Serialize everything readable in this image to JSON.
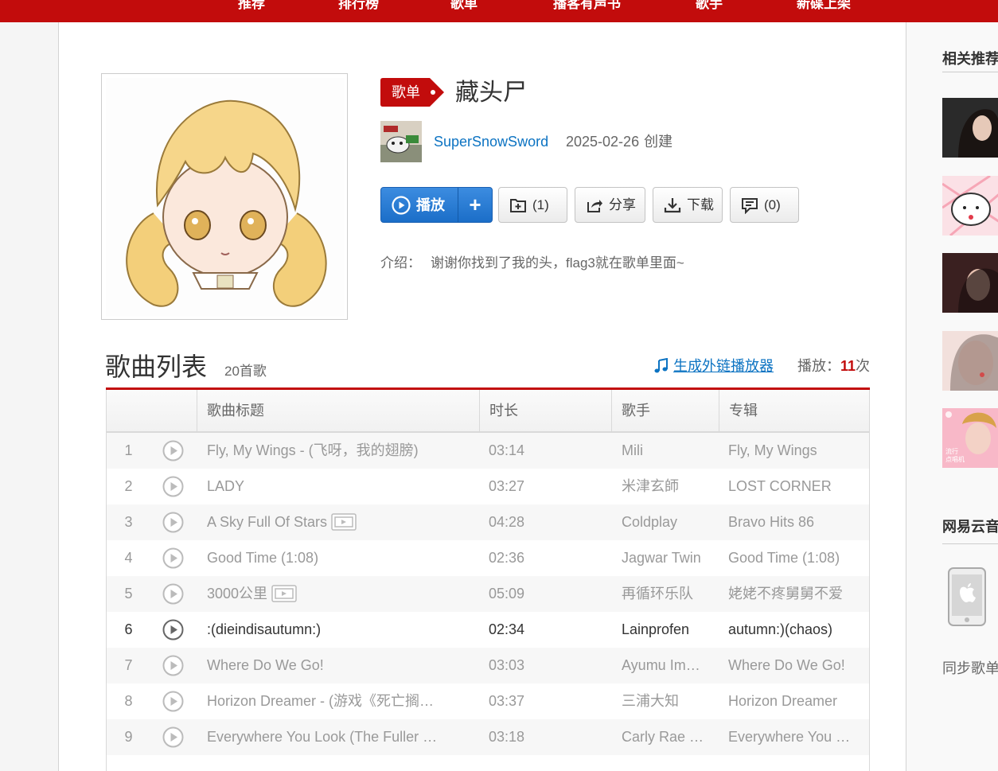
{
  "nav": {
    "items": [
      "推荐",
      "排行榜",
      "歌单",
      "播客有声书",
      "歌手",
      "新碟上架"
    ]
  },
  "playlist": {
    "badge": "歌单",
    "title": "藏头尸",
    "creator": "SuperSnowSword",
    "created_date": "2025-02-26",
    "created_suffix": "创建",
    "intro_label": "介绍：",
    "intro_text": "谢谢你找到了我的头，flag3就在歌单里面~"
  },
  "buttons": {
    "play": "播放",
    "add": "+",
    "collect": "(1)",
    "share": "分享",
    "download": "下载",
    "comment": "(0)"
  },
  "songlist": {
    "title": "歌曲列表",
    "count": "20首歌",
    "ext_player": "生成外链播放器",
    "play_label": "播放：",
    "play_count": "11",
    "play_unit": "次",
    "headers": [
      "",
      "歌曲标题",
      "时长",
      "歌手",
      "专辑"
    ],
    "rows": [
      {
        "idx": "1",
        "title": "Fly, My Wings - (飞呀，我的翅膀)",
        "mv": false,
        "duration": "03:14",
        "artist": "Mili",
        "album": "Fly, My Wings",
        "active": false
      },
      {
        "idx": "2",
        "title": "LADY",
        "mv": false,
        "duration": "03:27",
        "artist": "米津玄師",
        "album": "LOST CORNER",
        "active": false
      },
      {
        "idx": "3",
        "title": "A Sky Full Of Stars",
        "mv": true,
        "duration": "04:28",
        "artist": "Coldplay",
        "album": "Bravo Hits 86",
        "active": false
      },
      {
        "idx": "4",
        "title": "Good Time (1:08)",
        "mv": false,
        "duration": "02:36",
        "artist": "Jagwar Twin",
        "album": "Good Time (1:08)",
        "active": false
      },
      {
        "idx": "5",
        "title": "3000公里",
        "mv": true,
        "duration": "05:09",
        "artist": "再循环乐队",
        "album": "姥姥不疼舅舅不爱",
        "active": false
      },
      {
        "idx": "6",
        "title": ":(dieindisautumn:)",
        "mv": false,
        "duration": "02:34",
        "artist": "Lainprofen",
        "album": "autumn:)(chaos)",
        "active": true
      },
      {
        "idx": "7",
        "title": "Where Do We Go!",
        "mv": false,
        "duration": "03:03",
        "artist": "Ayumu Im…",
        "album": "Where Do We Go!",
        "active": false
      },
      {
        "idx": "8",
        "title": "Horizon Dreamer - (游戏《死亡搁…",
        "mv": false,
        "duration": "03:37",
        "artist": "三浦大知",
        "album": "Horizon Dreamer",
        "active": false
      },
      {
        "idx": "9",
        "title": "Everywhere You Look (The Fuller …",
        "mv": false,
        "duration": "03:18",
        "artist": "Carly Rae …",
        "album": "Everywhere You …",
        "active": false
      }
    ]
  },
  "sidebar": {
    "related_title": "相关推荐",
    "app_title": "网易云音",
    "sync_text": "同步歌单",
    "thumb_badge": "流行\n点唱机"
  },
  "colors": {
    "brand_red": "#c20c0c",
    "link_blue": "#0c73c2",
    "play_blue": "#2a7fd6"
  }
}
